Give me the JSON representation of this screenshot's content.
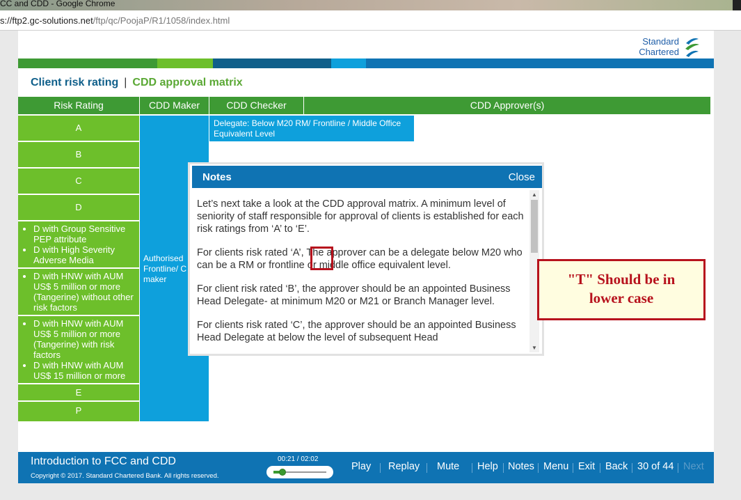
{
  "browser": {
    "window_title": "CC and CDD - Google Chrome",
    "url_host": "s://ftp2.gc-solutions.net",
    "url_path": "/ftp/qc/PoojaP/R1/1058/index.html"
  },
  "brand": {
    "line1": "Standard",
    "line2": "Chartered"
  },
  "colors": {
    "green": "#3e9a34",
    "light_green": "#6dbf2b",
    "blue": "#0f73b3",
    "cyan": "#0ea0dc",
    "red": "#b7121d"
  },
  "nav": {
    "tab_client": "Client risk rating",
    "separator": "|",
    "tab_cdd": "CDD approval matrix"
  },
  "matrix": {
    "headers": [
      "Risk Rating",
      "CDD Maker",
      "CDD Checker",
      "CDD Approver(s)"
    ],
    "ratings": {
      "a": "A",
      "b": "B",
      "c": "C",
      "d": "D",
      "g1": [
        "D with Group Sensitive PEP attribute",
        "D with High Severity Adverse Media"
      ],
      "g2": [
        "D with HNW with AUM US$ 5 million or more (Tangerine) without other risk factors"
      ],
      "g3": [
        "D with HNW with AUM US$ 5 million or more (Tangerine) with risk factors",
        "D with HNW with AUM US$ 15 million or more"
      ],
      "e": "E",
      "p": "P"
    },
    "maker_text": "Authorised Frontline/ C ops maker",
    "delegate_text": "Delegate: Below M20 RM/ Frontline / Middle Office Equivalent Level"
  },
  "notes": {
    "title": "Notes",
    "close": "Close",
    "paragraphs": [
      "Let’s next take a look at the CDD approval matrix. A minimum level of seniority of staff responsible for approval of clients is established for each risk ratings from ‘A’ to ‘E’.",
      "For clients risk rated ‘A’, The approver can be a delegate below M20 who can be a RM or frontline or middle office equivalent level.",
      "For client risk rated ‘B’, the approver should be an appointed Business Head Delegate- at minimum M20 or M21 or Branch Manager level.",
      "For clients risk rated ‘C’, the approver should be an appointed Business Head Delegate at below the level of subsequent Head"
    ]
  },
  "callout": {
    "line1": "\"T\" Should be in",
    "line2": "lower case"
  },
  "footer": {
    "course_title": "Introduction to FCC and CDD",
    "copyright": "Copyright © 2017. Standard Chartered Bank. All rights reserved.",
    "time": "00:21 / 02:02",
    "progress": 0.17,
    "buttons": {
      "play": "Play",
      "replay": "Replay",
      "mute": "Mute",
      "help": "Help",
      "notes": "Notes",
      "menu": "Menu",
      "exit": "Exit",
      "back": "Back",
      "page": "30 of 44",
      "next": "Next"
    }
  }
}
